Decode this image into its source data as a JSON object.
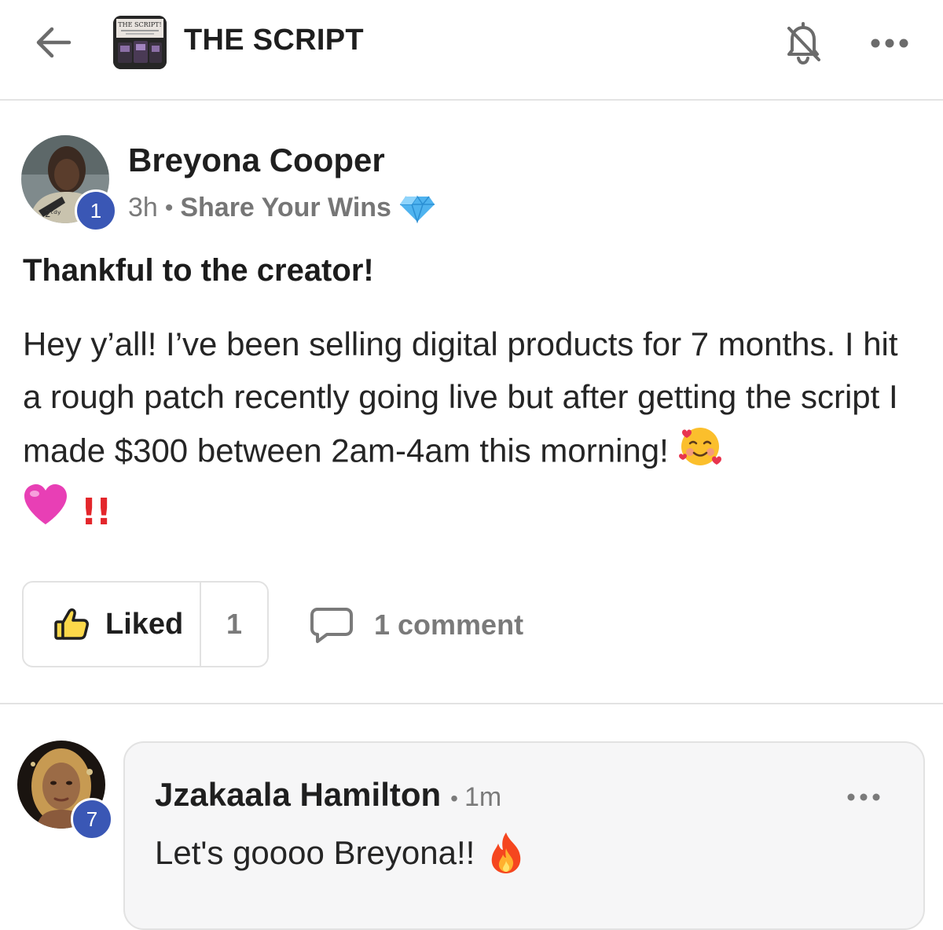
{
  "header": {
    "group_name": "THE SCRIPT",
    "logo_text": "THE SCRIPT!",
    "back_icon": "arrow-left-icon",
    "notifications_icon": "bell-off-icon",
    "more_icon": "more-horizontal-icon"
  },
  "post": {
    "author": {
      "name": "Breyona Cooper",
      "level": "1"
    },
    "time": "3h",
    "separator": "•",
    "category": "Share Your Wins",
    "category_icon": "gem-icon",
    "title": "Thankful to the creator!",
    "body": "Hey y’all! I’ve been selling digital products for 7 months. I hit a rough patch recently going live but after getting the script I made $300 between 2am-4am this morning!",
    "body_emojis": [
      "smiling-face-with-hearts-icon",
      "pink-heart-icon",
      "double-exclamation-icon"
    ],
    "exclamation": "!!",
    "actions": {
      "like_label": "Liked",
      "like_count": "1",
      "comments_label": "1 comment"
    }
  },
  "comments": [
    {
      "author": "Jzakaala Hamilton",
      "level": "7",
      "separator": "•",
      "time": "1m",
      "text": "Let's goooo Breyona!!",
      "emoji": "fire-icon"
    }
  ],
  "colors": {
    "badge": "#3a57b5",
    "muted_text": "#7a7a7a",
    "border": "#e2e2e2",
    "comment_bg": "#f6f6f7"
  }
}
